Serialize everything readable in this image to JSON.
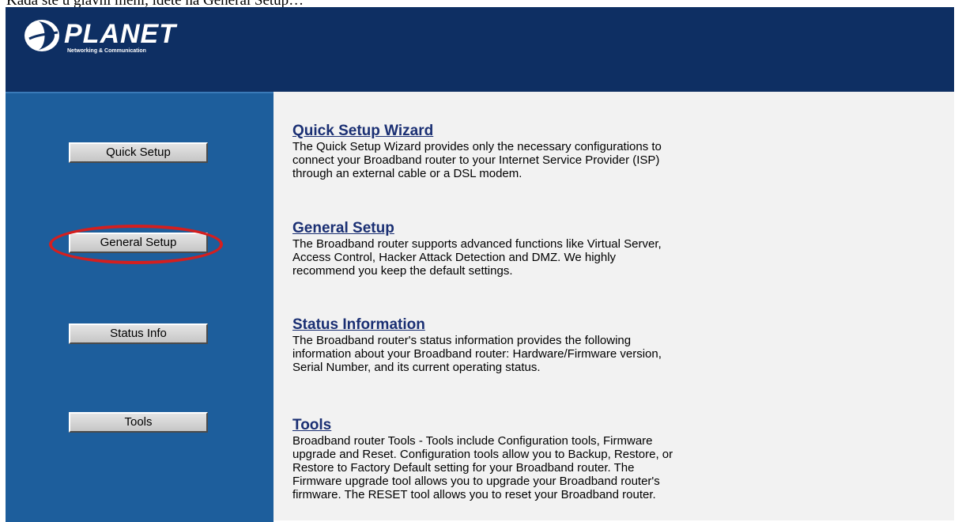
{
  "caption": "Kada ste u glavni meni, idete na General Setup…",
  "header": {
    "logo_text": "PLANET",
    "logo_sub": "Networking & Communication"
  },
  "sidebar": {
    "buttons": [
      {
        "label": "Quick Setup"
      },
      {
        "label": "General Setup",
        "highlighted": true
      },
      {
        "label": "Status Info"
      },
      {
        "label": "Tools"
      }
    ]
  },
  "sections": [
    {
      "title": "Quick Setup Wizard",
      "description": "The Quick Setup Wizard provides only the necessary configurations to\nconnect your Broadband router to your Internet Service Provider (ISP)\nthrough an external cable or a DSL modem."
    },
    {
      "title": "General Setup",
      "description": "The Broadband router supports advanced functions like Virtual Server,\nAccess Control, Hacker Attack Detection and DMZ. We highly\nrecommend you keep the default settings."
    },
    {
      "title": "Status Information",
      "description": "The Broadband router's status information provides the following\ninformation about your Broadband router: Hardware/Firmware version,\nSerial Number, and its current operating status."
    },
    {
      "title": "Tools",
      "description": "Broadband router Tools - Tools include Configuration tools, Firmware\nupgrade and Reset. Configuration tools allow you to Backup, Restore, or\nRestore to Factory Default setting for your Broadband router. The\nFirmware upgrade tool allows you to upgrade your Broadband router's\nfirmware. The RESET tool allows you to reset your Broadband router."
    }
  ],
  "colors": {
    "header_bg": "#0e2f63",
    "sidebar_bg": "#1d5e9c",
    "content_bg": "#f2f2f2",
    "link": "#1a2f73",
    "highlight_ring": "#d41f1f"
  }
}
